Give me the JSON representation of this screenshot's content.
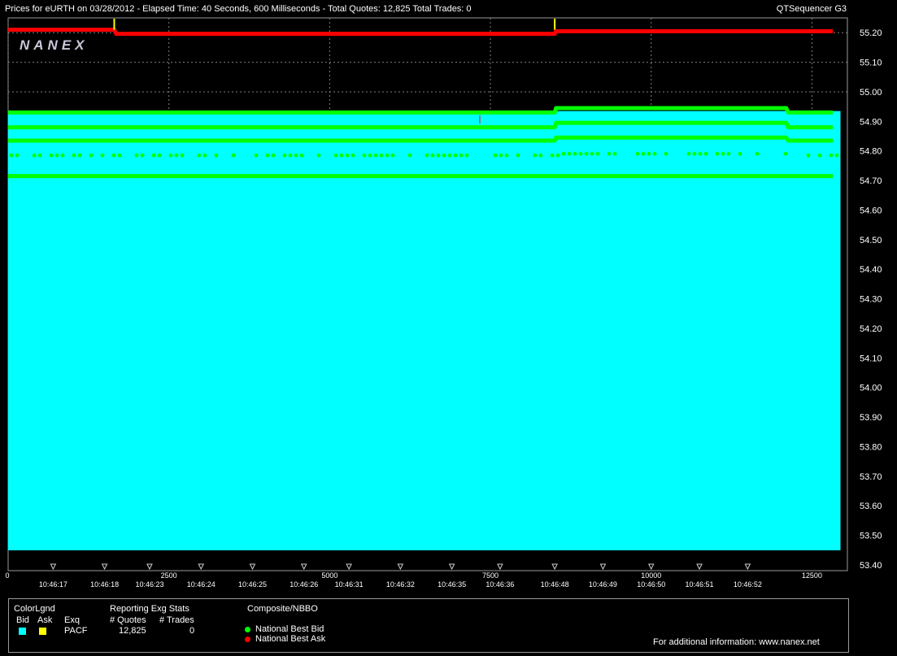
{
  "header": {
    "title": "Prices for  eURTH  on  03/28/2012  -  Elapsed Time: 40 Seconds, 600 Milliseconds  -  Total Quotes: 12,825  Total Trades: 0",
    "app": "QTSequencer G3"
  },
  "watermark": "NANEX",
  "colors": {
    "background": "#000000",
    "bid_fill": "#00ffff",
    "nbbo_bid": "#00ff00",
    "nbbo_ask": "#ff0000",
    "ask_marker": "#ffff00",
    "grid": "#808080"
  },
  "chart_data": {
    "type": "line",
    "x_range": [
      0,
      12825
    ],
    "ylim": [
      53.4,
      55.25
    ],
    "y_ticks": [
      "55.20",
      "55.10",
      "55.00",
      "54.90",
      "54.80",
      "54.70",
      "54.60",
      "54.50",
      "54.40",
      "54.30",
      "54.20",
      "54.10",
      "54.00",
      "53.90",
      "53.80",
      "53.70",
      "53.60",
      "53.50",
      "53.40"
    ],
    "x_ticks": [
      {
        "label": "0",
        "x": 0
      },
      {
        "label": "2500",
        "x": 2500
      },
      {
        "label": "5000",
        "x": 5000
      },
      {
        "label": "7500",
        "x": 7500
      },
      {
        "label": "10000",
        "x": 10000
      },
      {
        "label": "12500",
        "x": 12500
      }
    ],
    "time_labels": [
      {
        "label": "10:46:17",
        "x": 700
      },
      {
        "label": "10:46:18",
        "x": 1500
      },
      {
        "label": "10:46:23",
        "x": 2200
      },
      {
        "label": "10:46:24",
        "x": 3000
      },
      {
        "label": "10:46:25",
        "x": 3800
      },
      {
        "label": "10:46:26",
        "x": 4600
      },
      {
        "label": "10:46:31",
        "x": 5300
      },
      {
        "label": "10:46:32",
        "x": 6100
      },
      {
        "label": "10:46:35",
        "x": 6900
      },
      {
        "label": "10:46:36",
        "x": 7650
      },
      {
        "label": "10:46:48",
        "x": 8500
      },
      {
        "label": "10:46:49",
        "x": 9250
      },
      {
        "label": "10:46:50",
        "x": 10000
      },
      {
        "label": "10:46:51",
        "x": 10750
      },
      {
        "label": "10:46:52",
        "x": 11500
      }
    ],
    "grid": true,
    "series": [
      {
        "name": "National Best Ask",
        "color": "#ff0000",
        "points": [
          [
            0,
            55.21
          ],
          [
            1650,
            55.21
          ],
          [
            1680,
            55.196
          ],
          [
            8500,
            55.196
          ],
          [
            8520,
            55.205
          ],
          [
            12825,
            55.205
          ]
        ]
      },
      {
        "name": "National Best Bid",
        "color": "#00ff00",
        "points": [
          [
            0,
            54.93
          ],
          [
            8500,
            54.93
          ],
          [
            8520,
            54.945
          ],
          [
            12100,
            54.945
          ],
          [
            12130,
            54.93
          ],
          [
            12825,
            54.93
          ]
        ]
      }
    ],
    "bid_levels": [
      {
        "color": "#00ff00",
        "points": [
          [
            0,
            54.88
          ],
          [
            8500,
            54.88
          ],
          [
            8520,
            54.895
          ],
          [
            12100,
            54.895
          ],
          [
            12130,
            54.88
          ],
          [
            12825,
            54.88
          ]
        ]
      },
      {
        "color": "#00ff00",
        "points": [
          [
            0,
            54.835
          ],
          [
            8500,
            54.835
          ],
          [
            8520,
            54.845
          ],
          [
            12100,
            54.845
          ],
          [
            12130,
            54.835
          ],
          [
            12825,
            54.835
          ]
        ]
      },
      {
        "color": "#00ff00",
        "points": [
          [
            0,
            54.715
          ],
          [
            12825,
            54.715
          ]
        ]
      }
    ],
    "bid_fill_top": 54.935,
    "sparse_level": 54.785,
    "ask_markers_x": [
      1650,
      8500
    ]
  },
  "legend": {
    "color_legend": "ColorLgnd",
    "bid_label": "Bid",
    "ask_label": "Ask",
    "exq_label": "Exq",
    "exchange": "PACF",
    "stats_title": "Reporting Exg Stats",
    "quotes_label": "# Quotes",
    "trades_label": "# Trades",
    "quotes_value": "12,825",
    "trades_value": "0",
    "composite_title": "Composite/NBBO",
    "nbb_label": "National Best Bid",
    "nbo_label": "National Best Ask",
    "info": "For additional information: www.nanex.net"
  }
}
